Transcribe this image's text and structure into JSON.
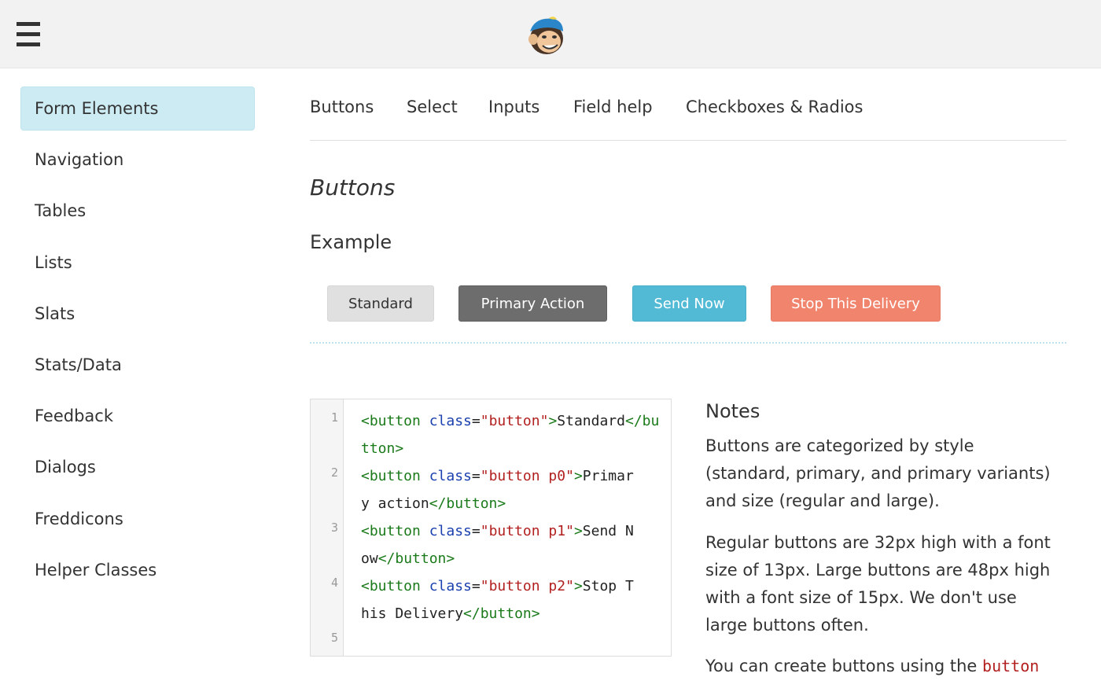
{
  "topbar": {
    "logo_icon": "freddie-monkey-logo",
    "menu_icon": "hamburger-menu-icon"
  },
  "sidebar": {
    "items": [
      {
        "label": "Form Elements",
        "active": true
      },
      {
        "label": "Navigation"
      },
      {
        "label": "Tables"
      },
      {
        "label": "Lists"
      },
      {
        "label": "Slats"
      },
      {
        "label": "Stats/Data"
      },
      {
        "label": "Feedback"
      },
      {
        "label": "Dialogs"
      },
      {
        "label": "Freddicons"
      },
      {
        "label": "Helper Classes"
      }
    ]
  },
  "tabs": [
    "Buttons",
    "Select",
    "Inputs",
    "Field help",
    "Checkboxes & Radios"
  ],
  "main": {
    "section_title": "Buttons",
    "example_title": "Example",
    "buttons": {
      "standard": "Standard",
      "primary": "Primary Action",
      "send": "Send Now",
      "stop": "Stop This Delivery"
    },
    "colors": {
      "standard": "#e0e0e0",
      "primary": "#6d6d6d",
      "send": "#52bad5",
      "stop": "#f0846c",
      "sidebar_active": "#cdebf3"
    }
  },
  "code": {
    "line_numbers": [
      "1",
      "2",
      "3",
      "4",
      "5"
    ],
    "lines": [
      [
        {
          "t": "tag",
          "v": "<button "
        },
        {
          "t": "attr",
          "v": "class"
        },
        {
          "t": "plain",
          "v": "="
        },
        {
          "t": "str",
          "v": "\"button\""
        },
        {
          "t": "tag",
          "v": ">"
        },
        {
          "t": "plain",
          "v": "Standard"
        },
        {
          "t": "tag",
          "v": "</bu"
        }
      ],
      [
        {
          "t": "tag",
          "v": "tton>"
        }
      ],
      [
        {
          "t": "tag",
          "v": "<button "
        },
        {
          "t": "attr",
          "v": "class"
        },
        {
          "t": "plain",
          "v": "="
        },
        {
          "t": "str",
          "v": "\"button p0\""
        },
        {
          "t": "tag",
          "v": ">"
        },
        {
          "t": "plain",
          "v": "Primar"
        }
      ],
      [
        {
          "t": "plain",
          "v": "y action"
        },
        {
          "t": "tag",
          "v": "</button>"
        }
      ],
      [
        {
          "t": "tag",
          "v": "<button "
        },
        {
          "t": "attr",
          "v": "class"
        },
        {
          "t": "plain",
          "v": "="
        },
        {
          "t": "str",
          "v": "\"button p1\""
        },
        {
          "t": "tag",
          "v": ">"
        },
        {
          "t": "plain",
          "v": "Send N"
        }
      ],
      [
        {
          "t": "plain",
          "v": "ow"
        },
        {
          "t": "tag",
          "v": "</button>"
        }
      ],
      [
        {
          "t": "tag",
          "v": "<button "
        },
        {
          "t": "attr",
          "v": "class"
        },
        {
          "t": "plain",
          "v": "="
        },
        {
          "t": "str",
          "v": "\"button p2\""
        },
        {
          "t": "tag",
          "v": ">"
        },
        {
          "t": "plain",
          "v": "Stop T"
        }
      ],
      [
        {
          "t": "plain",
          "v": "his Delivery"
        },
        {
          "t": "tag",
          "v": "</button>"
        }
      ],
      []
    ]
  },
  "notes": {
    "title": "Notes",
    "p1": "Buttons are categorized by style (standard, primary, and primary variants) and size (regular and large).",
    "p2": "Regular buttons are 32px high with a font size of 13px. Large buttons are 48px high with a font size of 15px. We don't use large buttons often.",
    "p3_prefix": "You can create buttons using the ",
    "p3_code": "button"
  }
}
